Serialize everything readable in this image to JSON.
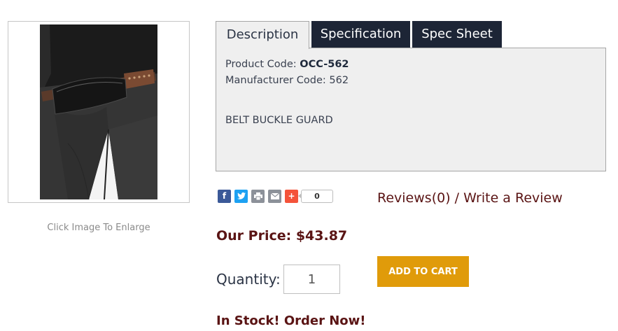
{
  "product_image": {
    "caption": "Click Image To Enlarge"
  },
  "tabs": [
    {
      "label": "Description",
      "active": true
    },
    {
      "label": "Specification",
      "active": false
    },
    {
      "label": "Spec Sheet",
      "active": false
    }
  ],
  "description": {
    "product_code_label": "Product Code: ",
    "product_code": "OCC-562",
    "manufacturer_code_label": "Manufacturer Code: ",
    "manufacturer_code": "562",
    "text": "BELT BUCKLE GUARD"
  },
  "share": {
    "icons": [
      "facebook-icon",
      "twitter-icon",
      "print-icon",
      "email-icon",
      "addthis-plus-icon"
    ],
    "count": "0"
  },
  "reviews": {
    "reviews_label": "Reviews(0)",
    "separator": " / ",
    "write_label": "Write a Review"
  },
  "price": {
    "label": "Our Price: $43.87"
  },
  "quantity": {
    "label": "Quantity:",
    "value": "1"
  },
  "cart": {
    "button_label": "ADD TO CART"
  },
  "stock": {
    "status": "In Stock! Order Now!"
  },
  "colors": {
    "tab_dark": "#1d2536",
    "panel_bg": "#efefef",
    "price_red": "#5a1414",
    "cart_orange": "#e09b0a"
  }
}
